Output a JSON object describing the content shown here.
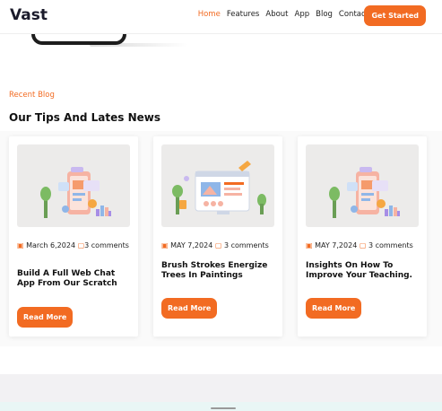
{
  "header": {
    "logo": "Vast",
    "nav": [
      "Home",
      "Features",
      "About",
      "App",
      "Blog",
      "Contact"
    ],
    "active_nav": "Home",
    "cta": "Get Started"
  },
  "section": {
    "kicker": "Recent Blog",
    "title": "Our Tips And Lates News"
  },
  "cards": [
    {
      "date": "March 6,2024",
      "comments": "3 comments",
      "title": "Build A Full Web Chat App From Our Scratch",
      "button": "Read More",
      "illustration": "app-design-illustration-icon"
    },
    {
      "date": "MAY 7,2024",
      "comments": "3 comments",
      "title": "Brush Strokes Energize Trees In Paintings",
      "button": "Read More",
      "illustration": "web-design-illustration-icon"
    },
    {
      "date": "MAY 7,2024",
      "comments": "3 comments",
      "title": "Insights On How To Improve Your Teaching.",
      "button": "Read More",
      "illustration": "app-design-illustration-icon"
    }
  ],
  "colors": {
    "accent": "#f26b22",
    "text": "#111111"
  }
}
